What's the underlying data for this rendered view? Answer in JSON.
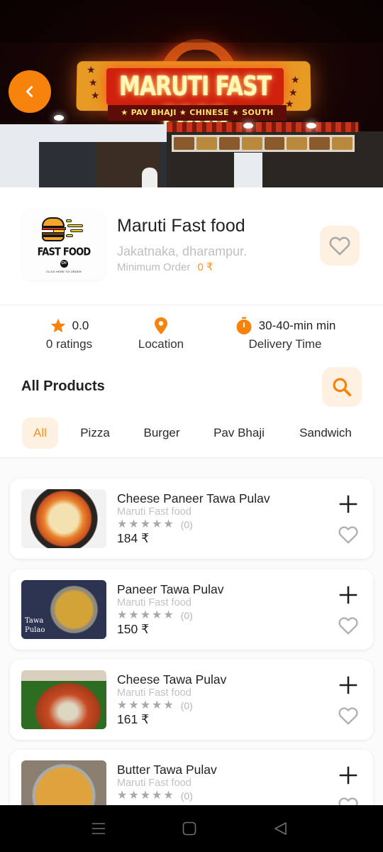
{
  "hero": {
    "sign_text": "MARUTI FAST FOOD",
    "sign_subtext": "★ PAV BHAJI ★ CHINESE ★ SOUTH INDIAN",
    "back_icon": "chevron-left-icon"
  },
  "restaurant": {
    "logo_title": "FAST FOOD",
    "logo_mark": "CH",
    "logo_tagline": "CLICK HERE TO ORDER",
    "name": "Maruti Fast food",
    "address": "Jakatnaka, dharampur.",
    "min_order_label": "Minimum Order",
    "min_order_value": "0 ₹",
    "favorite_icon": "heart-outline-icon"
  },
  "info": {
    "rating_value": "0.0",
    "rating_label": "0 ratings",
    "location_label": "Location",
    "delivery_value": "30-40-min min",
    "delivery_label": "Delivery Time"
  },
  "products": {
    "title": "All Products",
    "search_icon": "search-icon",
    "tabs": [
      {
        "label": "All",
        "active": true
      },
      {
        "label": "Pizza",
        "active": false
      },
      {
        "label": "Burger",
        "active": false
      },
      {
        "label": "Pav Bhaji",
        "active": false
      },
      {
        "label": "Sandwich",
        "active": false
      }
    ],
    "items": [
      {
        "name": "Cheese Paneer Tawa Pulav",
        "store": "Maruti Fast food",
        "rating_count": "(0)",
        "price": "184 ₹",
        "rating": 0
      },
      {
        "name": "Paneer Tawa Pulav",
        "store": "Maruti Fast food",
        "rating_count": "(0)",
        "price": "150 ₹",
        "rating": 0,
        "image_caption": "Tawa Pulao"
      },
      {
        "name": "Cheese Tawa Pulav",
        "store": "Maruti Fast food",
        "rating_count": "(0)",
        "price": "161 ₹",
        "rating": 0
      },
      {
        "name": "Butter Tawa Pulav",
        "store": "Maruti Fast food",
        "rating_count": "(0)",
        "price": "",
        "rating": 0
      }
    ]
  },
  "colors": {
    "accent": "#f7820c",
    "accent_text": "#f7931e",
    "accent_soft_bg": "#fff1e2",
    "muted_text": "#c0c0c0"
  },
  "navbar": {
    "buttons": [
      "menu-icon",
      "home-icon",
      "back-triangle-icon"
    ]
  }
}
